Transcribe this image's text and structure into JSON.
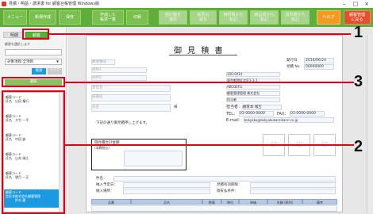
{
  "window": {
    "title": "見積・明品・請求書 for 顧客台帳管理 Windows版",
    "minimize": "–",
    "maximize": "□",
    "close": "×"
  },
  "toolbar": {
    "buttons": [
      {
        "label": "メニュー",
        "state": "normal"
      },
      {
        "label": "新規作成",
        "state": "normal"
      },
      {
        "label": "保存",
        "state": "normal"
      },
      {
        "label": "作成した\n帳票一覧",
        "state": "normal"
      },
      {
        "label": "印刷",
        "state": "normal"
      },
      {
        "label": "部印鑑を\n選択",
        "state": "disabled"
      },
      {
        "label": "帳票の\n複写",
        "state": "disabled"
      },
      {
        "label": "御見積から\n転記",
        "state": "disabled"
      },
      {
        "label": "納品書から\n転記",
        "state": "disabled"
      },
      {
        "label": "請求書から\n転記",
        "state": "disabled"
      },
      {
        "label": "ヘルプ",
        "state": "orange"
      },
      {
        "label": "顧客管理\nに戻る",
        "state": "red"
      }
    ]
  },
  "left_panel": {
    "tabs": [
      "明細",
      "顧客"
    ],
    "search_hint": "顧客を選択します",
    "filter_value": "対象項目:全項目",
    "search_button": "検索",
    "clear_button": "クリア",
    "select_button": "選択",
    "list": [
      {
        "code": "顧客コード",
        "name_label": "氏名",
        "name": "山田 権行",
        "company": ""
      },
      {
        "code": "顧客コード",
        "name_label": "氏名",
        "name": "大竹 一平",
        "company": ""
      },
      {
        "code": "顧客コード",
        "name_label": "氏名",
        "name": "中田 誠",
        "company": ""
      },
      {
        "code": "顧客コード",
        "name_label": "氏名",
        "name": "山本 瑞江",
        "company": ""
      },
      {
        "code": "顧客コード",
        "name_label": "氏名",
        "name": "望月 一正",
        "company": ""
      },
      {
        "code": "顧客コード",
        "name_label": "会社名",
        "name": "株式会社顧客管理",
        "company": "鈴木 健"
      }
    ]
  },
  "callouts": [
    "1",
    "2",
    "3"
  ],
  "document": {
    "title": "御 見 積 書",
    "issue_date_label": "発行日",
    "issue_date": "2016/06/24",
    "estimate_no_label": "見積 No.",
    "estimate_no": "00000000",
    "postal": "100-0014",
    "address": "東京都港区北区1-1-1",
    "company": "ABCDEFG",
    "company2": "顧客管理管理 株式会社",
    "dept_label": "担当者",
    "person_label": "担当者：",
    "person": "顧客本 報告",
    "tel_label": "TEL：",
    "tel": "03-0000-0000",
    "fax_label": "FAX：",
    "fax": "03-0000-0000",
    "email_label": "E-mail：",
    "email": "kokyaku@kokyakukanrikanri.co.jp",
    "recipient_placeholders": [
      "郵便番号",
      "住所1",
      "住所2",
      "会社名",
      "部署名",
      "氏名"
    ],
    "honorific": "様",
    "greeting": "下記の通り御見積申し上げます。",
    "total_label": "御見積合計金額",
    "total_sub": "(消費税込)",
    "stamp_label": "印",
    "subject_label": "件名：",
    "delivery_date_label": "納入予定日：",
    "delivery_place_label": "納入場所：",
    "validity_label": "見積有効期限：",
    "terms_label": "御支払条件：",
    "table_headers": [
      "品番",
      "品名",
      "数量",
      "単位",
      "単価",
      "金額 (税別)",
      "備考"
    ]
  }
}
